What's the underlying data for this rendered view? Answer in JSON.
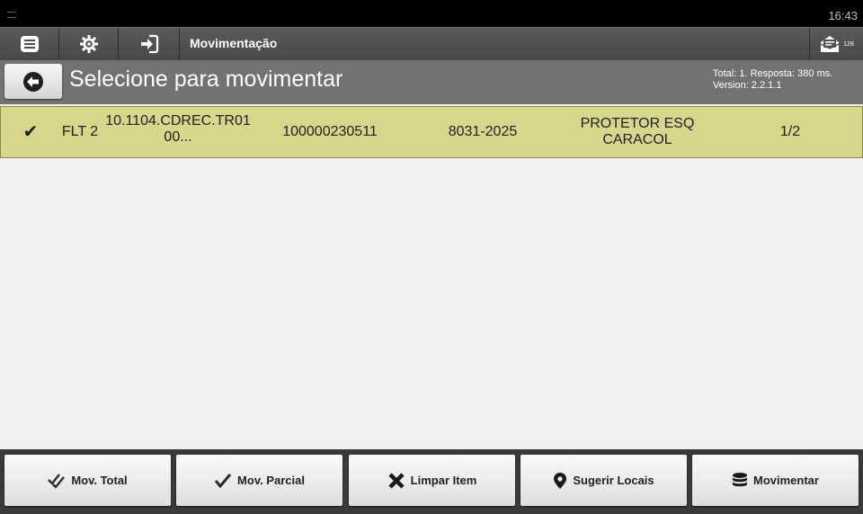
{
  "status_bar": {
    "time": "16:43"
  },
  "toolbar": {
    "title": "Movimentação",
    "message_count": "128"
  },
  "header": {
    "title": "Selecione para movimentar",
    "info_line1": "Total: 1. Resposta: 380 ms.",
    "info_line2": "Version: 2.2.1.1"
  },
  "rows": [
    {
      "check": "✔",
      "flt": "FLT 2",
      "code": "10.1104.CDREC.TR01\n00...",
      "number": "100000230511",
      "ref": "8031-2025",
      "description": "PROTETOR ESQ\nCARACOL",
      "qty": "1/2"
    }
  ],
  "footer": {
    "mov_total": "Mov. Total",
    "mov_parcial": "Mov. Parcial",
    "limpar_item": "Limpar Item",
    "sugerir_locais": "Sugerir Locais",
    "movimentar": "Movimentar"
  },
  "colors": {
    "selected_row": "#d8d68c",
    "toolbar": "#4f4f4f",
    "subheader": "#727272"
  },
  "icons": {
    "menu": "list-icon",
    "settings": "gear-icon",
    "logout": "sign-in-icon",
    "messages": "envelope-icon",
    "back": "arrow-left-circle-icon"
  }
}
